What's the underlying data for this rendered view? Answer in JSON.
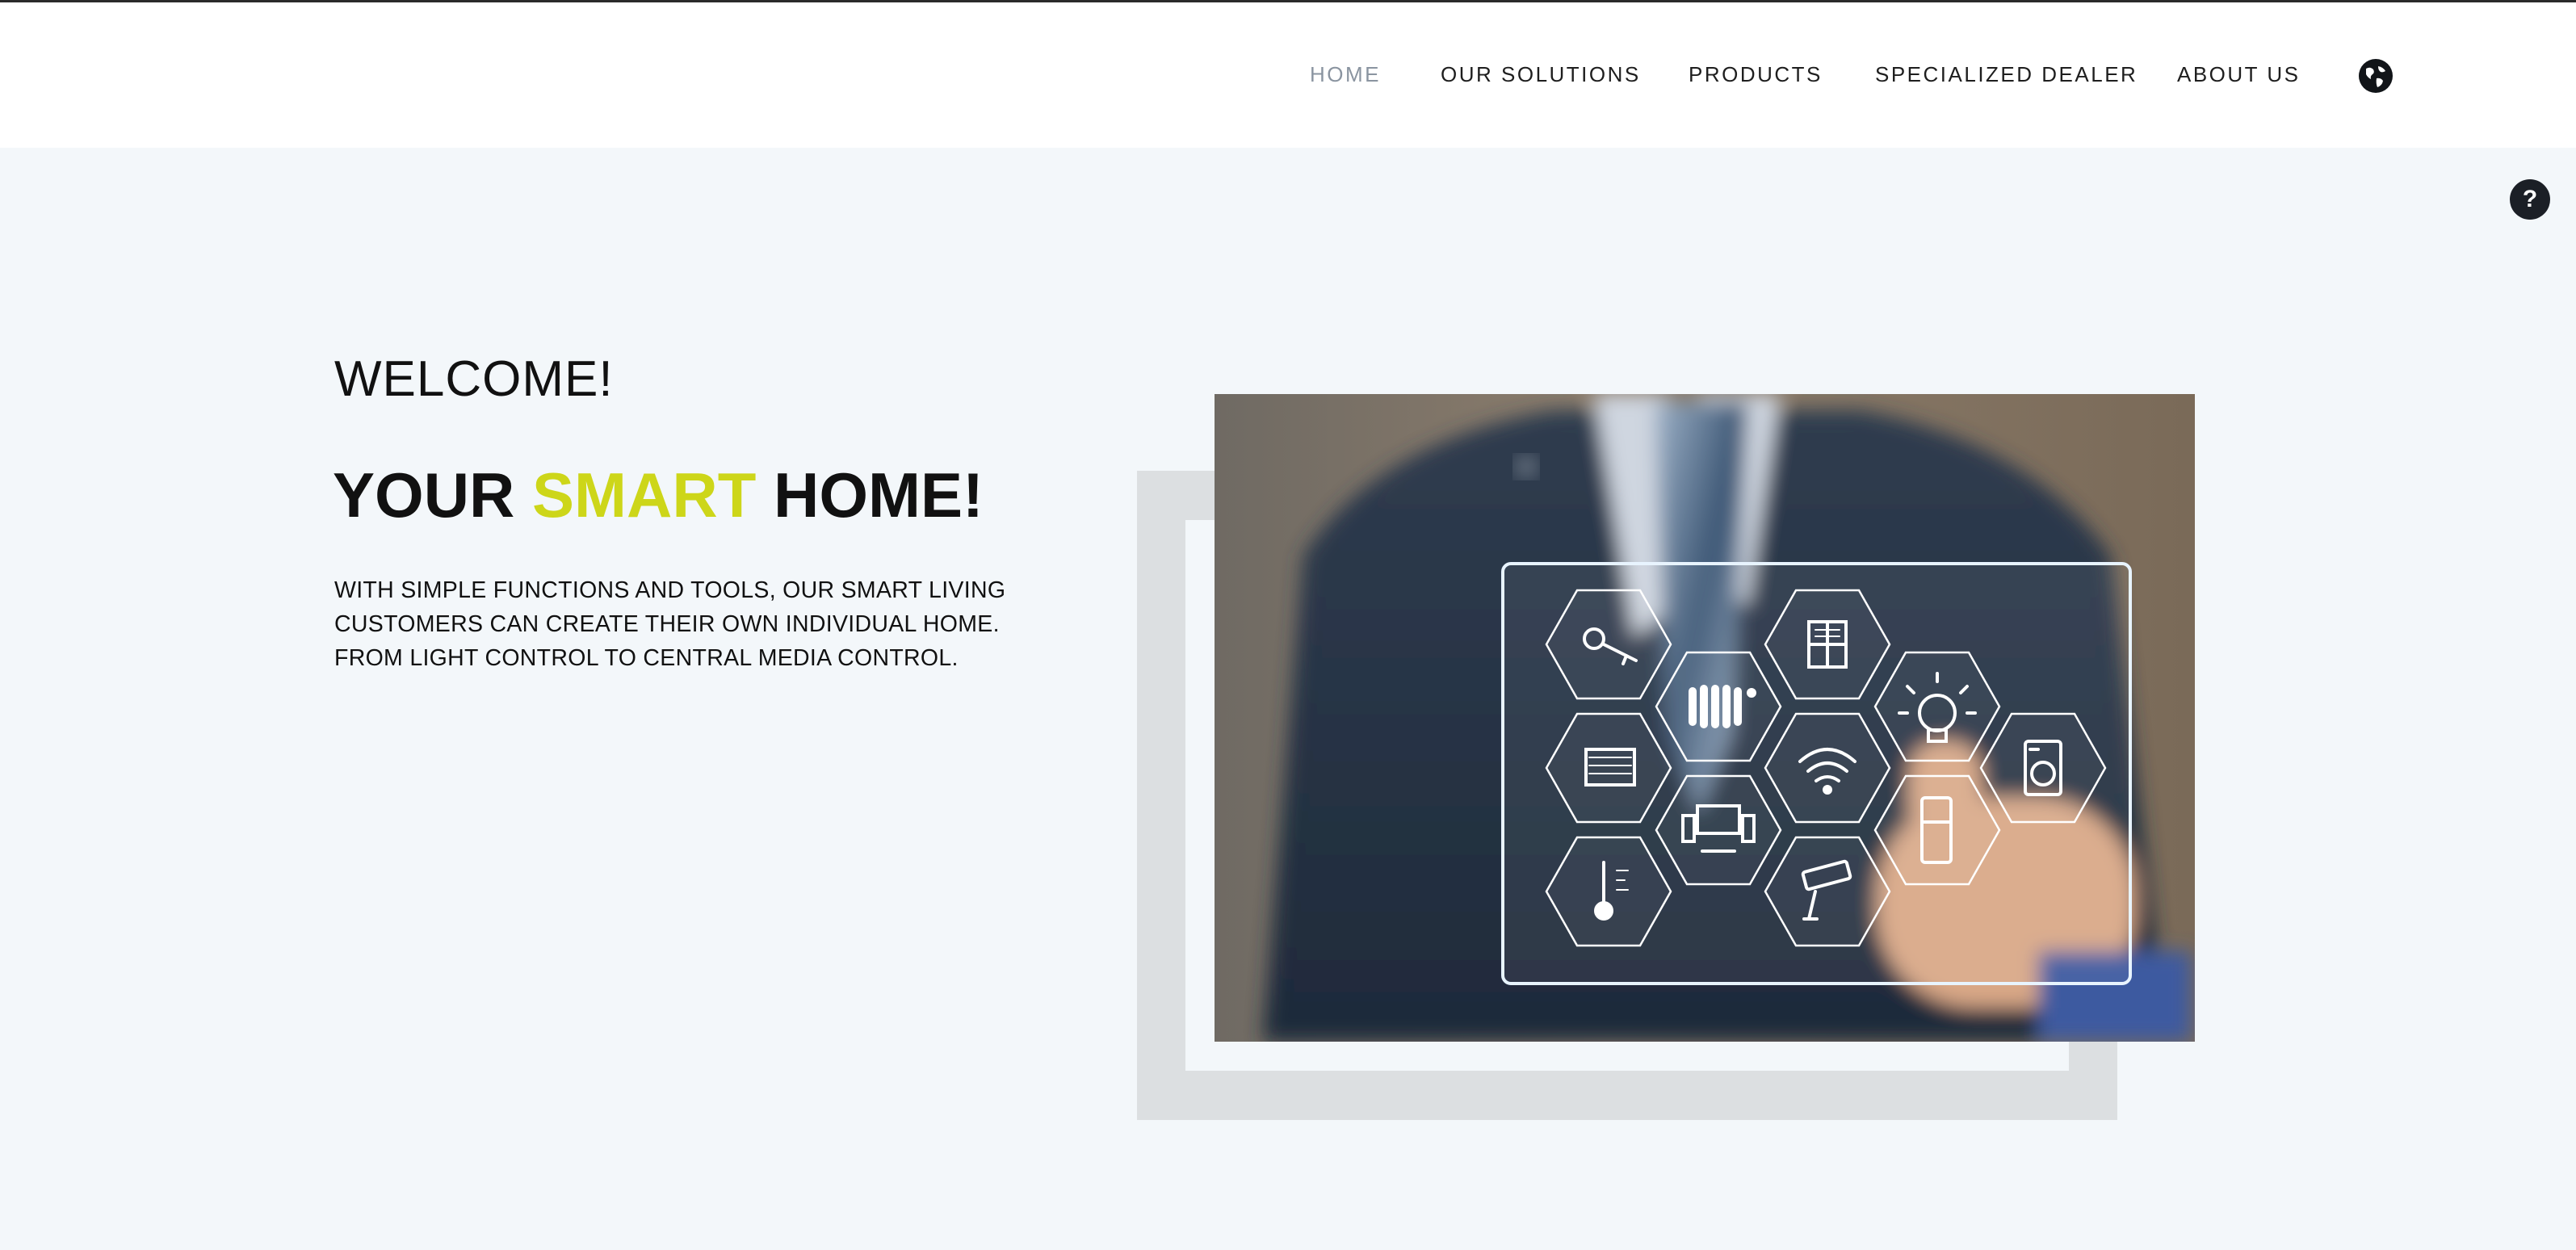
{
  "nav": {
    "items": [
      {
        "label": "HOME",
        "active": true
      },
      {
        "label": "OUR SOLUTIONS",
        "active": false
      },
      {
        "label": "PRODUCTS",
        "active": false
      },
      {
        "label": "SPECIALIZED DEALER",
        "active": false
      },
      {
        "label": "ABOUT US",
        "active": false
      }
    ],
    "language_icon": "globe-icon"
  },
  "help": {
    "label": "?",
    "icon": "help-icon"
  },
  "hero": {
    "welcome": "WELCOME!",
    "headline_part1": "YOUR",
    "headline_accent": "SMART",
    "headline_part2": "HOME!",
    "description": "WITH SIMPLE FUNCTIONS AND TOOLS, OUR SMART LIVING CUSTOMERS CAN CREATE THEIR OWN INDIVIDUAL HOME. FROM LIGHT CONTROL TO CENTRAL MEDIA CONTROL.",
    "image_icons": [
      "key-icon",
      "radiator-icon",
      "window-icon",
      "lightbulb-icon",
      "garage-icon",
      "wifi-icon",
      "washing-machine-icon",
      "media-system-icon",
      "fridge-icon",
      "thermometer-icon",
      "camera-icon"
    ]
  },
  "colors": {
    "accent": "#cdd619",
    "background": "#f3f7fa",
    "nav_active": "#8a94a0",
    "text": "#111111"
  }
}
